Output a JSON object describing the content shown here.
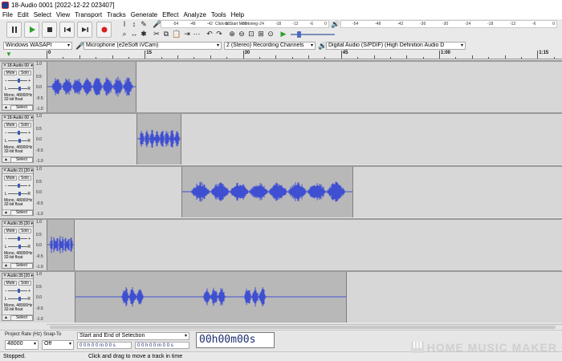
{
  "window": {
    "title": "18-Audio 0001 [2022-12-22 023407]"
  },
  "menu": [
    "File",
    "Edit",
    "Select",
    "View",
    "Transport",
    "Tracks",
    "Generate",
    "Effect",
    "Analyze",
    "Tools",
    "Help"
  ],
  "transport": {
    "pause_icon": "pause-icon",
    "play_icon": "play-icon",
    "stop_icon": "stop-icon",
    "skip_start_icon": "skip-to-start-icon",
    "skip_end_icon": "skip-to-end-icon",
    "record_icon": "record-icon",
    "colors": {
      "play": "#2aa02a",
      "record": "#d42020"
    }
  },
  "meters": {
    "record_ticks": [
      "-54",
      "-48",
      "-42",
      "-36",
      "-30",
      "-24",
      "-18",
      "-12",
      "-6",
      "0"
    ],
    "monitor_hint": "Click to Start Monitoring",
    "play_ticks": [
      "-54",
      "-48",
      "-42",
      "-36",
      "-30",
      "-24",
      "-18",
      "-12",
      "-6",
      "0"
    ]
  },
  "devices": {
    "host": "Windows WASAPI",
    "mic": "Microphone (e2eSoft iVCam)",
    "channels": "2 (Stereo) Recording Channels",
    "speaker": "Digital Audio (S/PDIF) (High Definition Audio D"
  },
  "ruler": {
    "labels": [
      "0",
      "15",
      "30",
      "45",
      "1:00",
      "1:15"
    ]
  },
  "tracks": [
    {
      "name": "18-Audio 00",
      "clip": {
        "start": 0,
        "end": 13.8
      },
      "bursts": [
        [
          0.05,
          0.95
        ]
      ]
    },
    {
      "name": "18-Audio 00",
      "clip": {
        "start": 13.8,
        "end": 20.6
      },
      "bursts": [
        [
          0.05,
          0.95
        ]
      ]
    },
    {
      "name": "Audio 21 [20",
      "clip": {
        "start": 20.6,
        "end": 46.9
      },
      "bursts": [
        [
          0.05,
          0.95
        ]
      ]
    },
    {
      "name": "Audio 35 [20",
      "clip": {
        "start": 0,
        "end": 4.3
      },
      "bursts": [
        [
          0.1,
          0.9
        ]
      ]
    },
    {
      "name": "Audio 35 [20",
      "clip": {
        "start": 4.3,
        "end": 45.9
      },
      "bursts": [
        [
          0.17,
          0.25
        ],
        [
          0.47,
          0.55
        ],
        [
          0.62,
          0.7
        ]
      ]
    }
  ],
  "track_common": {
    "mute": "Mute",
    "solo": "Solo",
    "l": "L",
    "r": "R",
    "rate_info": "Mono, 48000Hz",
    "format_info": "32-bit float",
    "select": "Select",
    "scale": [
      "1.0",
      "0.5",
      "0.0",
      "-0.5",
      "-1.0"
    ]
  },
  "selection_toolbar": {
    "project_rate_label": "Project Rate (Hz)",
    "project_rate": "48000",
    "snap_label": "Snap-To",
    "snap": "Off",
    "selection_mode": "Start and End of Selection",
    "sel_start": "0 0 h 0 0 m 0 0 s",
    "sel_end": "0 0 h 0 0 m 0 0 s",
    "time": "00h00m00s"
  },
  "status": {
    "state": "Stopped.",
    "hint": "Click and drag to move a track in time"
  },
  "watermark": "HOME MUSIC MAKER",
  "colors": {
    "waveform": "#3f4fd1",
    "clip_bg": "#b8b8b8",
    "track_bg": "#d7d7d7"
  }
}
